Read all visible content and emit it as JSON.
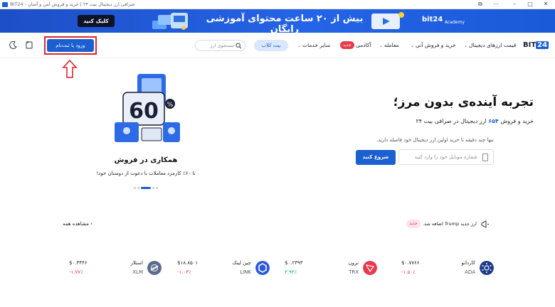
{
  "window": {
    "title": "صرافی ارز دیجیتال بیت ۲۴ | خرید و فروش امن و آسان - BIT24"
  },
  "banner": {
    "cta": "کلیک کنید",
    "text": "بیش از ۲۰ ساعت محتوای آموزشی رایگان",
    "brand": "bit24",
    "brand_sub": "Academy",
    "colors": {
      "bg": "#2564e6",
      "cta_bg": "#0e1427"
    }
  },
  "header": {
    "logo": {
      "part1": "BIT",
      "part2": "24"
    },
    "nav": [
      {
        "label": "قیمت ارزهای دیجیتال",
        "has_dropdown": true
      },
      {
        "label": "خرید و فروش آنی",
        "has_dropdown": true
      },
      {
        "label": "معامله",
        "has_dropdown": true
      },
      {
        "label": "آکادمی"
      },
      {
        "label": "سایر خدمات",
        "has_dropdown": true
      }
    ],
    "academy_badge": "جدید",
    "ticket_button": "بیت کلاب",
    "search_placeholder": "جستجوی ارز",
    "login_button": "ورود یا ثبت‌نام",
    "icons": [
      "moon-icon",
      "wallet-icon"
    ]
  },
  "hero": {
    "title": "تجربه آینده‌ی بدون مرز؛",
    "subtitle_pre": "خرید و فروش",
    "subtitle_count": "۶۵۴",
    "subtitle_post": "ارز دیجیتال در صرافی بیت ۲۴",
    "hint": "تنها چند دقیقه تا خرید اولین ارز دیجیتال خود فاصله دارید.",
    "phone_placeholder": "شماره موبایل خود را وارد کنید",
    "start_button": "شروع کنید"
  },
  "promo": {
    "title": "همکاری در فروش",
    "subtitle": "تا ۶۰٪ کارمزد معاملات با دعوت از دوستان خود!",
    "slides": 5,
    "active_slide": 2
  },
  "news": {
    "text": "ارز جدید Trump اضافه شد.",
    "badge": "جدید",
    "view_all": "مشاهده همه"
  },
  "tickers": [
    {
      "name": "کاردانو",
      "symbol": "ADA",
      "price": "$۰.۷۷۶۶",
      "change": "-۱.۵۰٪",
      "trend": "neg",
      "color": "#1e3a8a",
      "icon": "cardano-icon"
    },
    {
      "name": "ترون",
      "symbol": "TRX",
      "price": "$۰.۲۳۹۳",
      "change": "۳.۹۴٪",
      "trend": "pos",
      "color": "#e8394d",
      "icon": "tron-icon"
    },
    {
      "name": "چین لینک",
      "symbol": "LINK",
      "price": "$۱۸.۸۵۰۱",
      "change": "-۱.۰۳٪",
      "trend": "neg",
      "color": "#2a5ada",
      "icon": "chainlink-icon"
    },
    {
      "name": "استلار",
      "symbol": "XLM",
      "price": "$۰.۳۴۴۶",
      "change": "-۱.۷۷٪",
      "trend": "neg",
      "color": "#5a6b8c",
      "icon": "stellar-icon"
    }
  ]
}
